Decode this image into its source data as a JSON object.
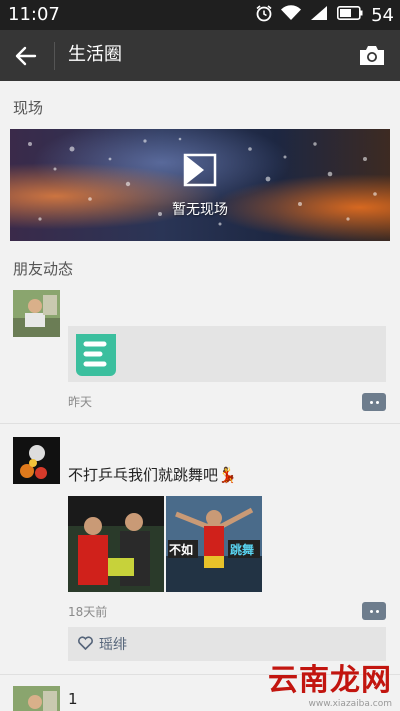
{
  "status_bar": {
    "time": "11:07",
    "battery_level": "54",
    "icons": [
      "alarm-icon",
      "wifi-icon",
      "signal-icon",
      "battery-icon"
    ]
  },
  "app_bar": {
    "title": "生活圈",
    "back_icon": "back-arrow-icon",
    "camera_icon": "camera-icon"
  },
  "live_section": {
    "heading": "现场",
    "banner_caption": "暂无现场"
  },
  "friends_section": {
    "heading": "朋友动态",
    "posts": [
      {
        "time": "昨天",
        "link_icon": "app-logo-icon",
        "text": ""
      },
      {
        "text": "不打乒乓我们就跳舞吧💃",
        "photo_2_overlay_left": "不如",
        "photo_2_overlay_right": "跳舞",
        "time": "18天前",
        "like_name": "瑶绯"
      },
      {
        "partial_text": "1"
      }
    ]
  },
  "watermark": {
    "text": "云南龙网",
    "subtext": "www.xiazaiba.com"
  },
  "colors": {
    "status_bar": "#1f1f1f",
    "app_bar": "#363636",
    "background": "#f2f2f2",
    "accent_teal": "#3bbf9e",
    "comment_button": "#6e7d8d"
  }
}
